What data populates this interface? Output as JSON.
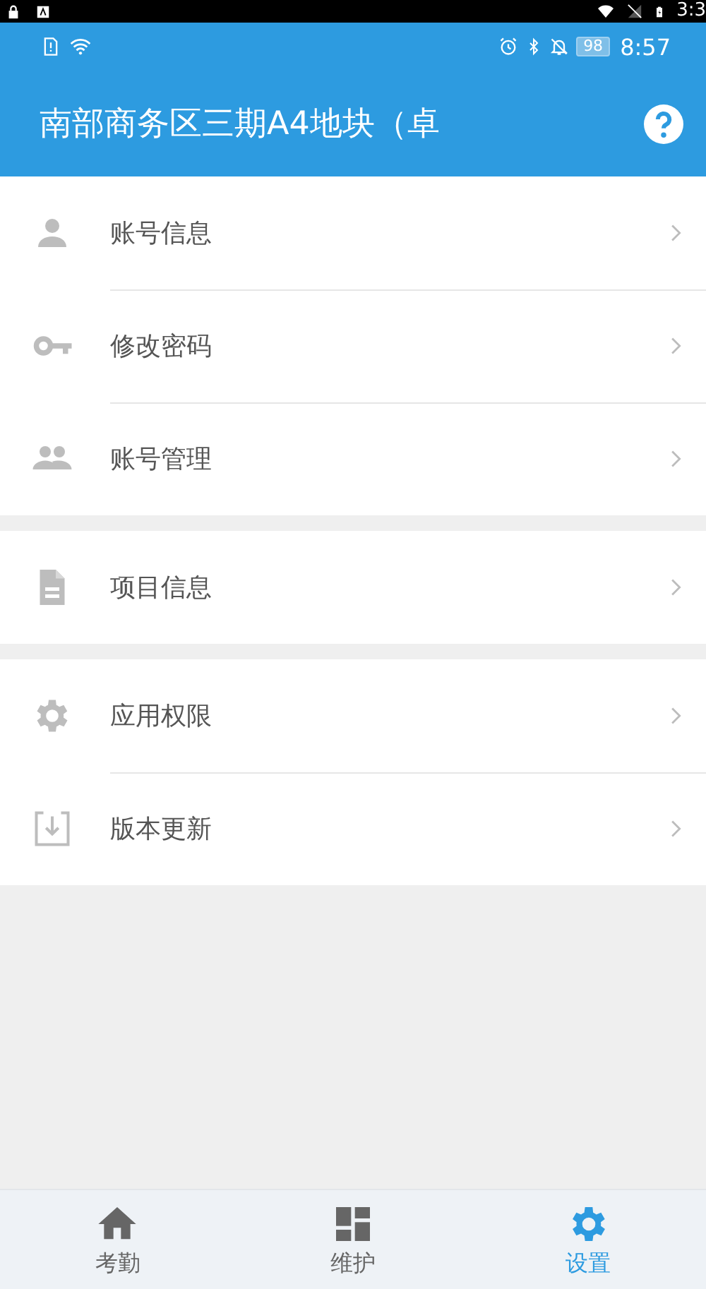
{
  "host_status_bar": {
    "time": "3:3"
  },
  "status_bar": {
    "battery": "98",
    "time": "8:57"
  },
  "title_bar": {
    "title": "南部商务区三期A4地块（卓"
  },
  "menu_groups": [
    {
      "items": [
        {
          "label": "账号信息"
        },
        {
          "label": "修改密码"
        },
        {
          "label": "账号管理"
        }
      ]
    },
    {
      "items": [
        {
          "label": "项目信息"
        }
      ]
    },
    {
      "items": [
        {
          "label": "应用权限"
        },
        {
          "label": "版本更新"
        }
      ]
    }
  ],
  "bottom_nav": [
    {
      "label": "考勤",
      "selected": false
    },
    {
      "label": "维护",
      "selected": false
    },
    {
      "label": "设置",
      "selected": true
    }
  ]
}
